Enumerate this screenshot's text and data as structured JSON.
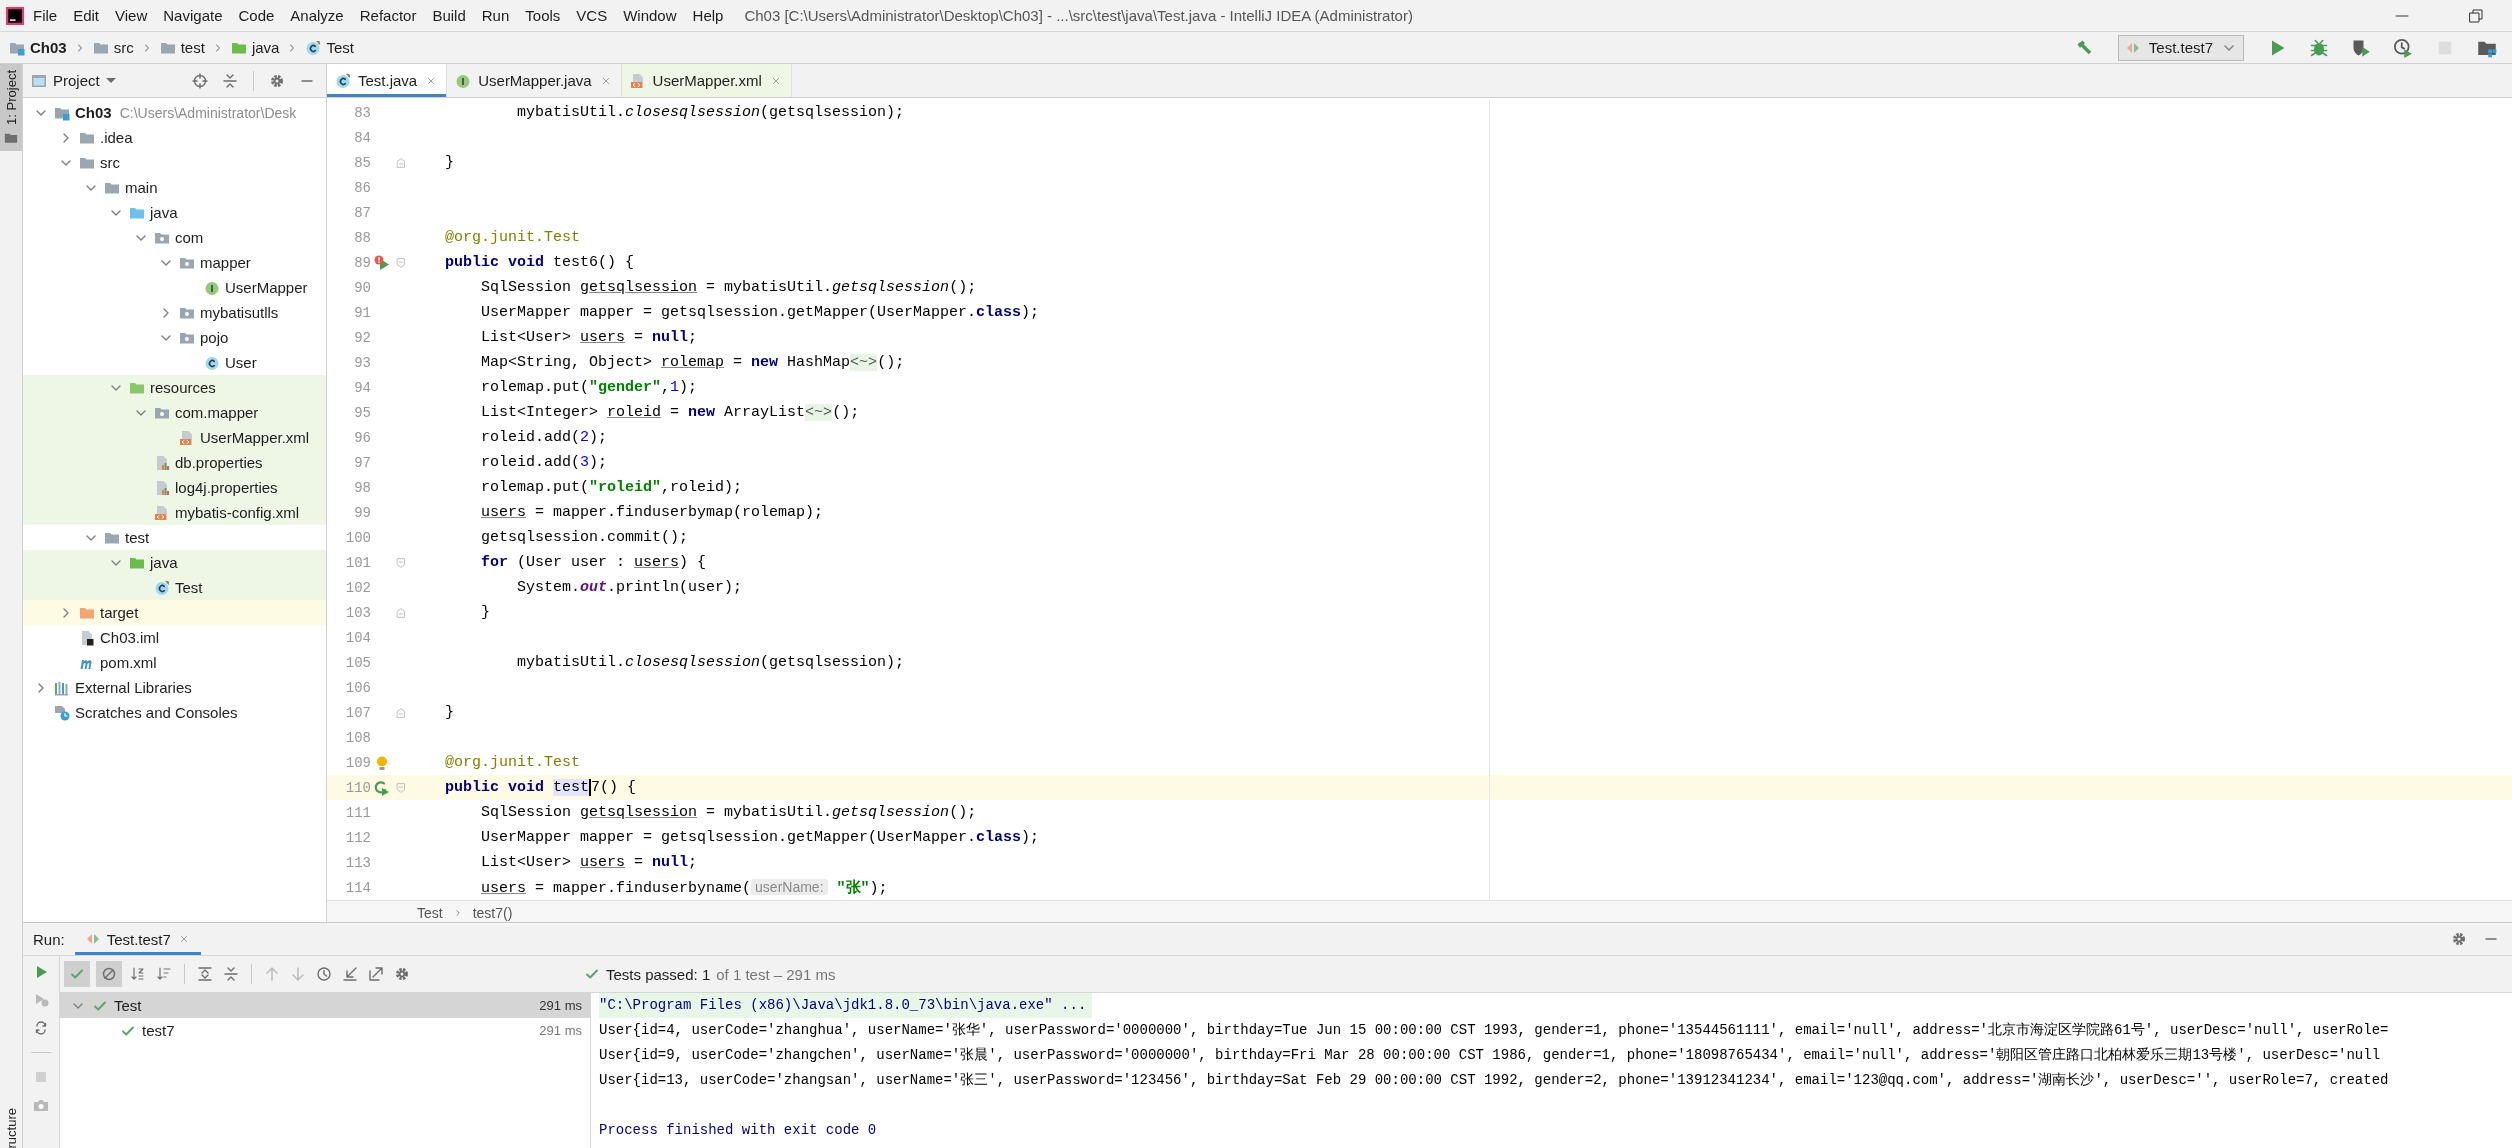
{
  "window": {
    "title": "Ch03 [C:\\Users\\Administrator\\Desktop\\Ch03] - ...\\src\\test\\java\\Test.java - IntelliJ IDEA (Administrator)"
  },
  "menu": [
    "File",
    "Edit",
    "View",
    "Navigate",
    "Code",
    "Analyze",
    "Refactor",
    "Build",
    "Run",
    "Tools",
    "VCS",
    "Window",
    "Help"
  ],
  "breadcrumb": [
    {
      "label": "Ch03",
      "kind": "module"
    },
    {
      "label": "src",
      "kind": "folder"
    },
    {
      "label": "test",
      "kind": "folder"
    },
    {
      "label": "java",
      "kind": "test-root"
    },
    {
      "label": "Test",
      "kind": "test-class"
    }
  ],
  "run_config": {
    "label": "Test.test7"
  },
  "toolbar": [
    {
      "kind": "build",
      "disabled": false
    },
    {
      "kind": "run",
      "disabled": false
    },
    {
      "kind": "debug",
      "disabled": false
    },
    {
      "kind": "coverage",
      "disabled": false
    },
    {
      "kind": "profile",
      "disabled": false
    },
    {
      "kind": "stop",
      "disabled": true
    },
    {
      "kind": "structure",
      "disabled": false
    }
  ],
  "side_tabs": [
    {
      "label": "1: Project",
      "selected": true
    },
    {
      "label": "ructure",
      "selected": false
    }
  ],
  "project": {
    "title": "Project",
    "tree": [
      {
        "label": "Ch03",
        "path": "C:\\Users\\Administrator\\Desk",
        "kind": "module",
        "expanded": true,
        "children": [
          {
            "label": ".idea",
            "kind": "folder",
            "expanded": false
          },
          {
            "label": "src",
            "kind": "folder",
            "expanded": true,
            "children": [
              {
                "label": "main",
                "kind": "folder",
                "expanded": true,
                "children": [
                  {
                    "label": "java",
                    "kind": "source",
                    "expanded": true,
                    "children": [
                      {
                        "label": "com",
                        "kind": "package",
                        "expanded": true,
                        "children": [
                          {
                            "label": "mapper",
                            "kind": "package",
                            "expanded": true,
                            "children": [
                              {
                                "label": "UserMapper",
                                "kind": "interface"
                              }
                            ]
                          },
                          {
                            "label": "mybatisutlls",
                            "kind": "package",
                            "expanded": false
                          },
                          {
                            "label": "pojo",
                            "kind": "package",
                            "expanded": true,
                            "children": [
                              {
                                "label": "User",
                                "kind": "class"
                              }
                            ]
                          }
                        ]
                      }
                    ]
                  },
                  {
                    "label": "resources",
                    "kind": "resource-root",
                    "expanded": true,
                    "tinted": true,
                    "children": [
                      {
                        "label": "com.mapper",
                        "kind": "package",
                        "expanded": true,
                        "tinted": true,
                        "children": [
                          {
                            "label": "UserMapper.xml",
                            "kind": "xml",
                            "tinted": true
                          }
                        ]
                      },
                      {
                        "label": "db.properties",
                        "kind": "properties",
                        "tinted": true
                      },
                      {
                        "label": "log4j.properties",
                        "kind": "properties",
                        "tinted": true
                      },
                      {
                        "label": "mybatis-config.xml",
                        "kind": "xml",
                        "tinted": true
                      }
                    ]
                  }
                ]
              },
              {
                "label": "test",
                "kind": "folder",
                "expanded": true,
                "children": [
                  {
                    "label": "java",
                    "kind": "test-root",
                    "expanded": true,
                    "tinted": true,
                    "children": [
                      {
                        "label": "Test",
                        "kind": "test-class",
                        "tinted": true
                      }
                    ]
                  }
                ]
              }
            ]
          },
          {
            "label": "target",
            "kind": "excluded",
            "expanded": false
          },
          {
            "label": "Ch03.iml",
            "kind": "iml"
          },
          {
            "label": "pom.xml",
            "kind": "pom"
          }
        ]
      },
      {
        "label": "External Libraries",
        "kind": "libraries",
        "expanded": false
      },
      {
        "label": "Scratches and Consoles",
        "kind": "scratches"
      }
    ]
  },
  "editor": {
    "tabs": [
      {
        "label": "Test.java",
        "kind": "test-class",
        "selected": true,
        "tinted": false
      },
      {
        "label": "UserMapper.java",
        "kind": "interface",
        "selected": false,
        "tinted": false
      },
      {
        "label": "UserMapper.xml",
        "kind": "xml",
        "selected": false,
        "tinted": true
      }
    ],
    "lines": [
      {
        "n": "83",
        "current": false,
        "tokens": [
          {
            "text": "            mybatisUtil.",
            "kind": "p"
          },
          {
            "text": "closesqlsession",
            "kind": "it"
          },
          {
            "text": "(getsqlsession);",
            "kind": "p"
          }
        ]
      },
      {
        "n": "84",
        "current": false
      },
      {
        "n": "85",
        "current": false,
        "fold": {
          "kind": "end"
        },
        "tokens": [
          {
            "text": "    }",
            "kind": "p"
          }
        ]
      },
      {
        "n": "86",
        "current": false
      },
      {
        "n": "87",
        "current": false
      },
      {
        "n": "88",
        "current": false,
        "tokens": [
          {
            "text": "    @org.junit.Test",
            "kind": "ann"
          }
        ]
      },
      {
        "n": "89",
        "current": false,
        "gutter": {
          "kind": "run-error"
        },
        "fold": {
          "kind": "start"
        },
        "tokens": [
          {
            "text": "    public void",
            "kind": "kw"
          },
          {
            "text": " test6() {",
            "kind": "p"
          }
        ]
      },
      {
        "n": "90",
        "current": false,
        "tokens": [
          {
            "text": "        SqlSession ",
            "kind": "p"
          },
          {
            "text": "getsqlsession",
            "kind": "ul"
          },
          {
            "text": " = mybatisUtil.",
            "kind": "p"
          },
          {
            "text": "getsqlsession",
            "kind": "it"
          },
          {
            "text": "();",
            "kind": "p"
          }
        ]
      },
      {
        "n": "91",
        "current": false,
        "tokens": [
          {
            "text": "        UserMapper mapper = getsqlsession.getMapper(UserMapper.",
            "kind": "p"
          },
          {
            "text": "class",
            "kind": "kw"
          },
          {
            "text": ");",
            "kind": "p"
          }
        ]
      },
      {
        "n": "92",
        "current": false,
        "tokens": [
          {
            "text": "        List<User> ",
            "kind": "p"
          },
          {
            "text": "users",
            "kind": "ul"
          },
          {
            "text": " = ",
            "kind": "p"
          },
          {
            "text": "null",
            "kind": "kw"
          },
          {
            "text": ";",
            "kind": "p"
          }
        ]
      },
      {
        "n": "93",
        "current": false,
        "tokens": [
          {
            "text": "        Map<String, Object> ",
            "kind": "p"
          },
          {
            "text": "rolemap",
            "kind": "ul"
          },
          {
            "text": " = ",
            "kind": "p"
          },
          {
            "text": "new",
            "kind": "kw"
          },
          {
            "text": " HashMap",
            "kind": "p"
          },
          {
            "text": "<~>",
            "kind": "dia"
          },
          {
            "text": "();",
            "kind": "p"
          }
        ]
      },
      {
        "n": "94",
        "current": false,
        "tokens": [
          {
            "text": "        rolemap.put(",
            "kind": "p"
          },
          {
            "text": "\"gender\"",
            "kind": "str"
          },
          {
            "text": ",",
            "kind": "p"
          },
          {
            "text": "1",
            "kind": "num"
          },
          {
            "text": ");",
            "kind": "p"
          }
        ]
      },
      {
        "n": "95",
        "current": false,
        "tokens": [
          {
            "text": "        List<Integer> ",
            "kind": "p"
          },
          {
            "text": "roleid",
            "kind": "ul"
          },
          {
            "text": " = ",
            "kind": "p"
          },
          {
            "text": "new",
            "kind": "kw"
          },
          {
            "text": " ArrayList",
            "kind": "p"
          },
          {
            "text": "<~>",
            "kind": "dia"
          },
          {
            "text": "();",
            "kind": "p"
          }
        ]
      },
      {
        "n": "96",
        "current": false,
        "tokens": [
          {
            "text": "        roleid.add(",
            "kind": "p"
          },
          {
            "text": "2",
            "kind": "num"
          },
          {
            "text": ");",
            "kind": "p"
          }
        ]
      },
      {
        "n": "97",
        "current": false,
        "tokens": [
          {
            "text": "        roleid.add(",
            "kind": "p"
          },
          {
            "text": "3",
            "kind": "num"
          },
          {
            "text": ");",
            "kind": "p"
          }
        ]
      },
      {
        "n": "98",
        "current": false,
        "tokens": [
          {
            "text": "        rolemap.put(",
            "kind": "p"
          },
          {
            "text": "\"roleid\"",
            "kind": "str"
          },
          {
            "text": ",roleid);",
            "kind": "p"
          }
        ]
      },
      {
        "n": "99",
        "current": false,
        "tokens": [
          {
            "text": "        users",
            "kind": "ul"
          },
          {
            "text": " = mapper.finduserbymap(rolemap);",
            "kind": "p"
          }
        ]
      },
      {
        "n": "100",
        "current": false,
        "tokens": [
          {
            "text": "        getsqlsession.commit();",
            "kind": "p"
          }
        ]
      },
      {
        "n": "101",
        "current": false,
        "fold": {
          "kind": "start"
        },
        "tokens": [
          {
            "text": "        for",
            "kind": "kw"
          },
          {
            "text": " (User user : ",
            "kind": "p"
          },
          {
            "text": "users",
            "kind": "ul"
          },
          {
            "text": ") {",
            "kind": "p"
          }
        ]
      },
      {
        "n": "102",
        "current": false,
        "tokens": [
          {
            "text": "            System.",
            "kind": "p"
          },
          {
            "text": "out",
            "kind": "sf"
          },
          {
            "text": ".println(user);",
            "kind": "p"
          }
        ]
      },
      {
        "n": "103",
        "current": false,
        "fold": {
          "kind": "end"
        },
        "tokens": [
          {
            "text": "        }",
            "kind": "p"
          }
        ]
      },
      {
        "n": "104",
        "current": false
      },
      {
        "n": "105",
        "current": false,
        "tokens": [
          {
            "text": "            mybatisUtil.",
            "kind": "p"
          },
          {
            "text": "closesqlsession",
            "kind": "it"
          },
          {
            "text": "(getsqlsession);",
            "kind": "p"
          }
        ]
      },
      {
        "n": "106",
        "current": false
      },
      {
        "n": "107",
        "current": false,
        "fold": {
          "kind": "end"
        },
        "tokens": [
          {
            "text": "    }",
            "kind": "p"
          }
        ]
      },
      {
        "n": "108",
        "current": false
      },
      {
        "n": "109",
        "current": false,
        "gutter": {
          "kind": "bulb"
        },
        "tokens": [
          {
            "text": "    @org.junit.Test",
            "kind": "ann"
          }
        ]
      },
      {
        "n": "110",
        "current": true,
        "gutter": {
          "kind": "run-passed"
        },
        "fold": {
          "kind": "start"
        },
        "tokens": [
          {
            "text": "    public void ",
            "kind": "kw"
          },
          {
            "text": "test",
            "kind": "sel"
          },
          {
            "text": "7() {",
            "kind": "p"
          }
        ]
      },
      {
        "n": "111",
        "current": false,
        "tokens": [
          {
            "text": "        SqlSession ",
            "kind": "p"
          },
          {
            "text": "getsqlsession",
            "kind": "ul"
          },
          {
            "text": " = mybatisUtil.",
            "kind": "p"
          },
          {
            "text": "getsqlsession",
            "kind": "it"
          },
          {
            "text": "();",
            "kind": "p"
          }
        ]
      },
      {
        "n": "112",
        "current": false,
        "tokens": [
          {
            "text": "        UserMapper mapper = getsqlsession.getMapper(UserMapper.",
            "kind": "p"
          },
          {
            "text": "class",
            "kind": "kw"
          },
          {
            "text": ");",
            "kind": "p"
          }
        ]
      },
      {
        "n": "113",
        "current": false,
        "tokens": [
          {
            "text": "        List<User> ",
            "kind": "p"
          },
          {
            "text": "users",
            "kind": "ul"
          },
          {
            "text": " = ",
            "kind": "p"
          },
          {
            "text": "null",
            "kind": "kw"
          },
          {
            "text": ";",
            "kind": "p"
          }
        ]
      },
      {
        "n": "114",
        "current": false,
        "tokens": [
          {
            "text": "        users",
            "kind": "ul"
          },
          {
            "text": " = mapper.finduserbyname(",
            "kind": "p"
          },
          {
            "text": "userName:",
            "kind": "hint"
          },
          {
            "text": " \"张\"",
            "kind": "str"
          },
          {
            "text": ");",
            "kind": "p"
          }
        ]
      }
    ],
    "breadcrumb": [
      "Test",
      "test7()"
    ]
  },
  "run": {
    "label": "Run:",
    "tab": "Test.test7",
    "status": "Tests passed: 1",
    "status_detail": "of 1 test – 291 ms",
    "filters": [
      {
        "kind": "passed",
        "selected": true
      },
      {
        "kind": "ignored",
        "selected": true
      }
    ],
    "tree": [
      {
        "label": "Test",
        "time": "291 ms",
        "passed": true,
        "selected": true,
        "expanded": true,
        "children": [
          {
            "label": "test7",
            "time": "291 ms",
            "passed": true,
            "selected": false
          }
        ]
      }
    ],
    "console": [
      {
        "kind": "command",
        "text": "\"C:\\Program Files (x86)\\Java\\jdk1.8.0_73\\bin\\java.exe\" ..."
      },
      {
        "kind": "output",
        "text": "User{id=4, userCode='zhanghua', userName='张华', userPassword='0000000', birthday=Tue Jun 15 00:00:00 CST 1993, gender=1, phone='13544561111', email='null', address='北京市海淀区学院路61号', userDesc='null', userRole="
      },
      {
        "kind": "output",
        "text": "User{id=9, userCode='zhangchen', userName='张晨', userPassword='0000000', birthday=Fri Mar 28 00:00:00 CST 1986, gender=1, phone='18098765434', email='null', address='朝阳区管庄路口北柏林爱乐三期13号楼', userDesc='null"
      },
      {
        "kind": "output",
        "text": "User{id=13, userCode='zhangsan', userName='张三', userPassword='123456', birthday=Sat Feb 29 00:00:00 CST 1992, gender=2, phone='13912341234', email='123@qq.com', address='湖南长沙', userDesc='', userRole=7, created"
      },
      {
        "kind": "exit",
        "text": "Process finished with exit code 0"
      }
    ]
  }
}
